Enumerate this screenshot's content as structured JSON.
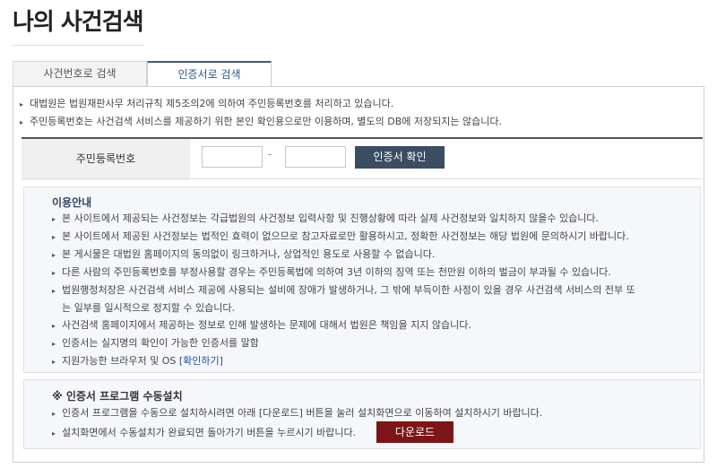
{
  "page": {
    "title": "나의 사건검색"
  },
  "tabs": [
    {
      "label": "사건번호로 검색"
    },
    {
      "label": "인증서로 검색"
    }
  ],
  "notices": [
    "대법원은 법원재판사무 처리규칙 제5조의2에 의하여 주민등록번호를 처리하고 있습니다.",
    "주민등록번호는 사건검색 서비스를 제공하기 위한 본인 확인용으로만 이용하며, 별도의 DB에 저장되지는 않습니다."
  ],
  "id_form": {
    "label": "주민등록번호",
    "first_value": "",
    "second_value": "",
    "separator": "-",
    "button_label": "인증서 확인"
  },
  "guide": {
    "title": "이용안내",
    "items": [
      "본 사이트에서 제공되는 사건정보는 각급법원의 사건정보 입력사항 및 진행상황에 따라 실제 사건정보와 일치하지 않을수 있습니다.",
      "본 사이트에서 제공된 사건정보는 법적인 효력이 없으므로 참고자료로만 활용하시고, 정확한 사건정보는 해당 법원에 문의하시기 바랍니다.",
      "본 게시물은 대법원 홈페이지의 동의없이 링크하거나, 상업적인 용도로 사용할 수 없습니다.",
      "다른 사람의 주민등록번호를 부정사용할 경우는 주민등록법에 의하여 3년 이하의 징역 또는 천만원 이하의 벌금이 부과될 수 있습니다.",
      "법원행정처장은 사건검색 서비스 제공에 사용되는 설비에 장애가 발생하거나, 그 밖에 부득이한 사정이 있을 경우 사건검색 서비스의 전부 또",
      "사건검색 홈페이지에서 제공하는 정보로 인해 발생하는 문제에 대해서 법원은 책임을 지지 않습니다.",
      "인증서는 실지명의 확인이 가능한 인증서를 말함",
      "지원가능한 브라우저 및 OS"
    ],
    "item5_cont": "는 일부를 일시적으로 정지할 수 있습니다.",
    "item8_link": "[확인하기]"
  },
  "install": {
    "title": "※ 인증서 프로그램 수동설치",
    "line1": "인증서 프로그램을 수동으로 설치하시려면 아래 [다운로드] 버튼을 눌러 설치화면으로 이동하여 설치하시기 바랍니다.",
    "line2": "설치화면에서 수동설치가 완료되면 돌아가기 버튼을 누르시기 바랍니다.",
    "download_label": "다운로드"
  },
  "colors": {
    "tab_active": "#2d5a88",
    "confirm_button": "#3a4d62",
    "download_button": "#7d1416",
    "link": "#1f4da8"
  }
}
